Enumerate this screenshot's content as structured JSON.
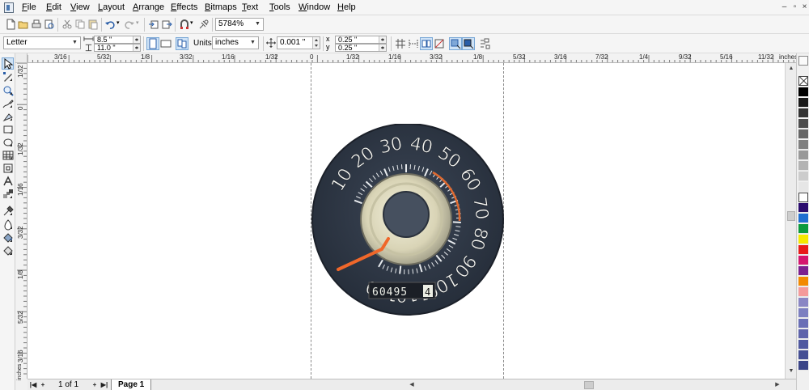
{
  "menu": {
    "items": [
      "File",
      "Edit",
      "View",
      "Layout",
      "Arrange",
      "Effects",
      "Bitmaps",
      "Text",
      "Tools",
      "Window",
      "Help"
    ],
    "window_controls": [
      "–",
      "▫",
      "×"
    ]
  },
  "standard_toolbar": {
    "zoom_value": "5784%",
    "icons": [
      "new-icon",
      "open-icon",
      "print-icon",
      "print-preview-icon",
      "cut-icon",
      "copy-icon",
      "paste-icon",
      "undo-icon",
      "redo-icon",
      "import-icon",
      "export-icon",
      "snap-to-icon",
      "welcome-icon"
    ]
  },
  "property_bar": {
    "page_size": "Letter",
    "page_width": "8.5 \"",
    "page_height": "11.0 \"",
    "units_label": "Units:",
    "units_value": "inches",
    "nudge_value": "0.001 \"",
    "dup_x_label": "x",
    "dup_x": "0.25 \"",
    "dup_y_label": "y",
    "dup_y": "0.25 \""
  },
  "toolbox": {
    "tools": [
      "pick-tool-icon",
      "shape-tool-icon",
      "zoom-tool-icon",
      "freehand-tool-icon",
      "smart-fill-icon",
      "rectangle-tool-icon",
      "ellipse-tool-icon",
      "polygon-tool-icon",
      "text-tool-icon",
      "table-tool-icon",
      "interactive-blend-icon",
      "eyedropper-icon",
      "outline-tool-icon",
      "fill-tool-icon",
      "interactive-fill-icon"
    ]
  },
  "rulers": {
    "horizontal_labels": [
      "3/16",
      "5/32",
      "1/8",
      "3/32",
      "1/16",
      "1/32",
      "0",
      "1/32",
      "1/16",
      "3/32",
      "1/8",
      "5/32",
      "3/16",
      "7/32",
      "1/4",
      "9/32",
      "5/16",
      "11/32",
      "inches"
    ],
    "vertical_labels": [
      "1/32",
      "0",
      "1/32",
      "1/16",
      "3/32",
      "1/8",
      "5/32",
      "3/16"
    ],
    "units_label": "inches"
  },
  "speedometer": {
    "dial_numbers": [
      "10",
      "20",
      "30",
      "40",
      "50",
      "60",
      "70",
      "80",
      "90",
      "100",
      "110",
      "120"
    ],
    "odometer": "60495",
    "odometer_last": "4",
    "needle_value": 0
  },
  "palette": {
    "colors": [
      "#000000",
      "#1a1a1a",
      "#333333",
      "#4d4d4d",
      "#666666",
      "#808080",
      "#999999",
      "#b3b3b3",
      "#cccccc",
      "#e6e6e6",
      "#ffffff",
      "#2b0c6e",
      "#1f6fd0",
      "#0a9a3c",
      "#f5e800",
      "#e81a1a",
      "#d4156e",
      "#7b1f8f",
      "#f28a00",
      "#f49a9a",
      "#8a86c4",
      "#7c7fc0",
      "#6a6fb6",
      "#5e63ab",
      "#5059a0",
      "#454f94",
      "#3b4588"
    ]
  },
  "page_bar": {
    "page_count": "1 of 1",
    "page_tab": "Page 1"
  }
}
